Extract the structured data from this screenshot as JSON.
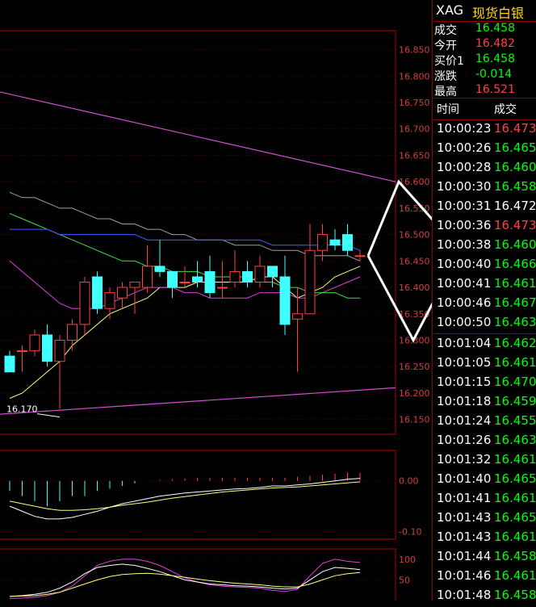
{
  "header": {
    "symbol": "XAG",
    "name": "现货白银"
  },
  "quote": [
    {
      "label": "成交",
      "value": "16.458",
      "color": "#00ff00"
    },
    {
      "label": "今开",
      "value": "16.482",
      "color": "#ff4040"
    },
    {
      "label": "买价1",
      "value": "16.458",
      "color": "#00ff00"
    },
    {
      "label": "涨跌",
      "value": "-0.014",
      "color": "#00ff00"
    },
    {
      "label": "最高",
      "value": "16.521",
      "color": "#ff4040"
    }
  ],
  "ticks_header": {
    "time": "时间",
    "price": "成交"
  },
  "ticks": [
    {
      "time": "10:00:23",
      "price": "16.473",
      "color": "#ff4040"
    },
    {
      "time": "10:00:26",
      "price": "16.465",
      "color": "#00ff00"
    },
    {
      "time": "10:00:28",
      "price": "16.460",
      "color": "#00ff00"
    },
    {
      "time": "10:00:30",
      "price": "16.458",
      "color": "#00ff00"
    },
    {
      "time": "10:00:31",
      "price": "16.472",
      "color": "#ffffff"
    },
    {
      "time": "10:00:36",
      "price": "16.473",
      "color": "#ff4040"
    },
    {
      "time": "10:00:38",
      "price": "16.460",
      "color": "#00ff00"
    },
    {
      "time": "10:00:40",
      "price": "16.466",
      "color": "#00ff00"
    },
    {
      "time": "10:00:41",
      "price": "16.461",
      "color": "#00ff00"
    },
    {
      "time": "10:00:46",
      "price": "16.467",
      "color": "#00ff00"
    },
    {
      "time": "10:00:50",
      "price": "16.463",
      "color": "#00ff00"
    },
    {
      "time": "10:01:04",
      "price": "16.462",
      "color": "#00ff00"
    },
    {
      "time": "10:01:05",
      "price": "16.461",
      "color": "#00ff00"
    },
    {
      "time": "10:01:15",
      "price": "16.470",
      "color": "#00ff00"
    },
    {
      "time": "10:01:18",
      "price": "16.459",
      "color": "#00ff00"
    },
    {
      "time": "10:01:24",
      "price": "16.455",
      "color": "#00ff00"
    },
    {
      "time": "10:01:26",
      "price": "16.463",
      "color": "#00ff00"
    },
    {
      "time": "10:01:32",
      "price": "16.461",
      "color": "#00ff00"
    },
    {
      "time": "10:01:40",
      "price": "16.465",
      "color": "#00ff00"
    },
    {
      "time": "10:01:41",
      "price": "16.461",
      "color": "#00ff00"
    },
    {
      "time": "10:01:43",
      "price": "16.465",
      "color": "#00ff00"
    },
    {
      "time": "10:01:43",
      "price": "16.461",
      "color": "#00ff00"
    },
    {
      "time": "10:01:44",
      "price": "16.458",
      "color": "#00ff00"
    },
    {
      "time": "10:01:46",
      "price": "16.461",
      "color": "#00ff00"
    },
    {
      "time": "10:01:48",
      "price": "16.458",
      "color": "#00ff00"
    }
  ],
  "colors": {
    "frame": "#b00000",
    "axis_text": "#d04040",
    "up": "#ff4040",
    "down": "#40ffff",
    "ma_yellow": "#ffff80",
    "ma_magenta": "#e040e0",
    "ma_green": "#40e040",
    "ma_blue": "#4060ff",
    "ma_gray": "#a0a0a0",
    "line_magenta": "#d050d0",
    "arrow": "#ffffff"
  },
  "chart_data": {
    "type": "candlestick",
    "y_ticks": [
      "16.850",
      "16.800",
      "16.750",
      "16.700",
      "16.650",
      "16.600",
      "16.550",
      "16.500",
      "16.450",
      "16.400",
      "16.350",
      "16.300",
      "16.250",
      "16.200",
      "16.150"
    ],
    "y_tick_values": [
      16.85,
      16.8,
      16.75,
      16.7,
      16.65,
      16.6,
      16.55,
      16.5,
      16.45,
      16.4,
      16.35,
      16.3,
      16.25,
      16.2,
      16.15
    ],
    "ylim": [
      16.122,
      16.886
    ],
    "annotation": {
      "label": "16.170",
      "value": 16.17,
      "candle_index": 4
    },
    "candles": [
      {
        "o": 16.27,
        "h": 16.28,
        "l": 16.25,
        "c": 16.24
      },
      {
        "o": 16.28,
        "h": 16.29,
        "l": 16.24,
        "c": 16.28
      },
      {
        "o": 16.28,
        "h": 16.32,
        "l": 16.27,
        "c": 16.31
      },
      {
        "o": 16.31,
        "h": 16.33,
        "l": 16.25,
        "c": 16.26
      },
      {
        "o": 16.26,
        "h": 16.31,
        "l": 16.17,
        "c": 16.3
      },
      {
        "o": 16.3,
        "h": 16.34,
        "l": 16.28,
        "c": 16.33
      },
      {
        "o": 16.33,
        "h": 16.42,
        "l": 16.31,
        "c": 16.41
      },
      {
        "o": 16.42,
        "h": 16.43,
        "l": 16.35,
        "c": 16.36
      },
      {
        "o": 16.36,
        "h": 16.4,
        "l": 16.34,
        "c": 16.39
      },
      {
        "o": 16.38,
        "h": 16.41,
        "l": 16.36,
        "c": 16.4
      },
      {
        "o": 16.4,
        "h": 16.41,
        "l": 16.35,
        "c": 16.41
      },
      {
        "o": 16.4,
        "h": 16.48,
        "l": 16.39,
        "c": 16.44
      },
      {
        "o": 16.44,
        "h": 16.49,
        "l": 16.42,
        "c": 16.43
      },
      {
        "o": 16.43,
        "h": 16.43,
        "l": 16.38,
        "c": 16.4
      },
      {
        "o": 16.41,
        "h": 16.44,
        "l": 16.4,
        "c": 16.41
      },
      {
        "o": 16.42,
        "h": 16.45,
        "l": 16.4,
        "c": 16.41
      },
      {
        "o": 16.43,
        "h": 16.46,
        "l": 16.38,
        "c": 16.39
      },
      {
        "o": 16.4,
        "h": 16.45,
        "l": 16.38,
        "c": 16.4
      },
      {
        "o": 16.41,
        "h": 16.47,
        "l": 16.4,
        "c": 16.43
      },
      {
        "o": 16.43,
        "h": 16.45,
        "l": 16.4,
        "c": 16.41
      },
      {
        "o": 16.41,
        "h": 16.46,
        "l": 16.4,
        "c": 16.44
      },
      {
        "o": 16.44,
        "h": 16.44,
        "l": 16.4,
        "c": 16.42
      },
      {
        "o": 16.42,
        "h": 16.46,
        "l": 16.31,
        "c": 16.33
      },
      {
        "o": 16.34,
        "h": 16.4,
        "l": 16.24,
        "c": 16.35
      },
      {
        "o": 16.35,
        "h": 16.52,
        "l": 16.35,
        "c": 16.47
      },
      {
        "o": 16.47,
        "h": 16.52,
        "l": 16.45,
        "c": 16.5
      },
      {
        "o": 16.49,
        "h": 16.51,
        "l": 16.47,
        "c": 16.48
      },
      {
        "o": 16.5,
        "h": 16.52,
        "l": 16.46,
        "c": 16.47
      },
      {
        "o": 16.46,
        "h": 16.47,
        "l": 16.45,
        "c": 16.46
      }
    ],
    "ma_lines": [
      {
        "color_key": "ma_yellow",
        "values": [
          16.19,
          16.2,
          16.22,
          16.24,
          16.26,
          16.29,
          16.31,
          16.33,
          16.35,
          16.36,
          16.37,
          16.38,
          16.4,
          16.4,
          16.4,
          16.41,
          16.41,
          16.41,
          16.41,
          16.41,
          16.42,
          16.42,
          16.4,
          16.38,
          16.39,
          16.4,
          16.42,
          16.43,
          16.44
        ]
      },
      {
        "color_key": "ma_magenta",
        "values": [
          16.45,
          16.43,
          16.41,
          16.39,
          16.37,
          16.36,
          16.36,
          16.36,
          16.37,
          16.38,
          16.39,
          16.4,
          16.4,
          16.4,
          16.39,
          16.39,
          16.38,
          16.38,
          16.38,
          16.38,
          16.39,
          16.39,
          16.39,
          16.38,
          16.38,
          16.39,
          16.4,
          16.41,
          16.42
        ]
      },
      {
        "color_key": "ma_green",
        "values": [
          16.54,
          16.53,
          16.52,
          16.51,
          16.5,
          16.49,
          16.48,
          16.47,
          16.46,
          16.45,
          16.45,
          16.44,
          16.44,
          16.43,
          16.43,
          16.43,
          16.42,
          16.42,
          16.42,
          16.42,
          16.41,
          16.41,
          16.4,
          16.4,
          16.39,
          16.39,
          16.39,
          16.38,
          16.38
        ]
      },
      {
        "color_key": "ma_gray",
        "values": [
          16.58,
          16.57,
          16.57,
          16.56,
          16.55,
          16.55,
          16.54,
          16.53,
          16.53,
          16.52,
          16.52,
          16.51,
          16.51,
          16.5,
          16.5,
          16.49,
          16.49,
          16.49,
          16.48,
          16.48,
          16.48,
          16.47,
          16.47,
          16.47,
          16.46,
          16.46,
          16.46,
          16.46,
          16.45
        ]
      },
      {
        "color_key": "ma_blue",
        "values": [
          16.51,
          16.51,
          16.51,
          16.51,
          16.5,
          16.5,
          16.5,
          16.5,
          16.5,
          16.5,
          16.5,
          16.49,
          16.49,
          16.49,
          16.49,
          16.49,
          16.49,
          16.49,
          16.49,
          16.49,
          16.49,
          16.48,
          16.48,
          16.48,
          16.48,
          16.48,
          16.48,
          16.48,
          16.47
        ]
      }
    ],
    "trend_lines": [
      {
        "from_value": 16.77,
        "to_value": 16.6
      },
      {
        "from_value": 16.16,
        "to_value": 16.21
      }
    ],
    "macd": {
      "y_ticks": [
        "0.00",
        "-0.10"
      ],
      "y_tick_values": [
        0.0,
        -0.1
      ],
      "ylim": [
        -0.115,
        0.06
      ],
      "bars": [
        -0.02,
        -0.03,
        -0.04,
        -0.05,
        -0.04,
        -0.03,
        -0.03,
        -0.02,
        -0.015,
        -0.01,
        -0.005,
        0.0,
        0.002,
        0.004,
        0.005,
        0.006,
        0.006,
        0.006,
        0.006,
        0.006,
        0.006,
        0.006,
        0.006,
        0.008,
        0.01,
        0.012,
        0.014,
        0.016,
        0.016
      ],
      "dif": [
        -0.05,
        -0.06,
        -0.07,
        -0.075,
        -0.075,
        -0.072,
        -0.066,
        -0.06,
        -0.052,
        -0.045,
        -0.04,
        -0.035,
        -0.03,
        -0.027,
        -0.024,
        -0.022,
        -0.02,
        -0.018,
        -0.016,
        -0.015,
        -0.013,
        -0.01,
        -0.01,
        -0.008,
        -0.006,
        -0.003,
        0.0,
        0.003,
        0.005
      ],
      "dea": [
        -0.04,
        -0.045,
        -0.05,
        -0.055,
        -0.058,
        -0.058,
        -0.057,
        -0.055,
        -0.052,
        -0.048,
        -0.045,
        -0.042,
        -0.038,
        -0.034,
        -0.031,
        -0.028,
        -0.025,
        -0.022,
        -0.02,
        -0.018,
        -0.016,
        -0.014,
        -0.013,
        -0.012,
        -0.01,
        -0.008,
        -0.006,
        -0.004,
        -0.002
      ]
    },
    "kdj": {
      "y_ticks": [
        "100",
        "50"
      ],
      "y_tick_values": [
        100,
        50
      ],
      "ylim": [
        0,
        125
      ],
      "k": [
        10,
        12,
        15,
        20,
        30,
        45,
        65,
        80,
        85,
        88,
        85,
        78,
        70,
        60,
        50,
        45,
        40,
        38,
        36,
        35,
        33,
        30,
        28,
        30,
        50,
        70,
        80,
        78,
        75
      ],
      "d": [
        10,
        11,
        12,
        15,
        20,
        30,
        40,
        50,
        58,
        63,
        65,
        66,
        64,
        60,
        56,
        52,
        48,
        45,
        42,
        40,
        38,
        35,
        33,
        33,
        40,
        50,
        60,
        65,
        68
      ],
      "j": [
        5,
        6,
        8,
        12,
        20,
        35,
        60,
        85,
        95,
        100,
        100,
        95,
        85,
        70,
        55,
        45,
        38,
        35,
        33,
        32,
        30,
        25,
        22,
        27,
        60,
        90,
        100,
        95,
        92
      ]
    }
  }
}
